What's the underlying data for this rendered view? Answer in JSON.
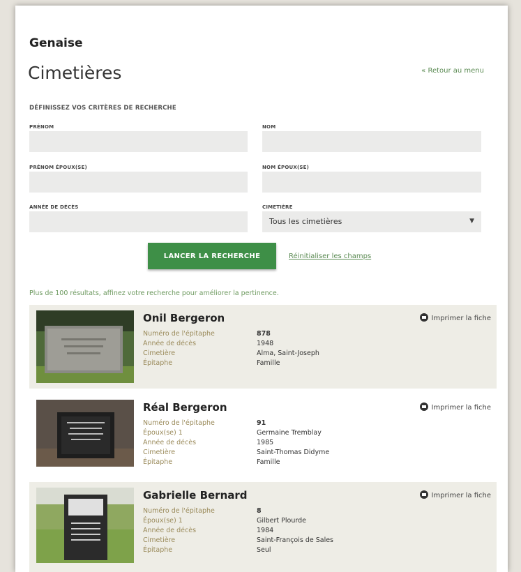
{
  "header": {
    "site_title": "Genaise",
    "page_title": "Cimetières",
    "back_link": "« Retour au menu"
  },
  "search": {
    "heading": "DÉFINISSEZ VOS CRITÈRES DE RECHERCHE",
    "fields": {
      "prenom": "PRÉNOM",
      "nom": "NOM",
      "prenom_epoux": "PRÉNOM ÉPOUX(SE)",
      "nom_epoux": "NOM ÉPOUX(SE)",
      "annee_deces": "ANNÉE DE DÉCÈS",
      "cimetiere": "CIMETIÈRE"
    },
    "cimetiere_selected": "Tous les cimetières",
    "search_button": "LANCER LA RECHERCHE",
    "reset_link": "Réinitialiser les champs",
    "notice": "Plus de 100 résultats, affinez votre recherche pour améliorer la pertinence."
  },
  "results": [
    {
      "name": "Onil Bergeron",
      "print_label": "Imprimer la fiche",
      "rows": [
        {
          "label": "Numéro de l'épitaphe",
          "value": "878"
        },
        {
          "label": "Année de décès",
          "value": "1948"
        },
        {
          "label": "Cimetière",
          "value": "Alma, Saint-Joseph"
        },
        {
          "label": "Épitaphe",
          "value": "Famille"
        }
      ]
    },
    {
      "name": "Réal Bergeron",
      "print_label": "Imprimer la fiche",
      "rows": [
        {
          "label": "Numéro de l'épitaphe",
          "value": "91"
        },
        {
          "label": "Époux(se) 1",
          "value": "Germaine Tremblay"
        },
        {
          "label": "Année de décès",
          "value": "1985"
        },
        {
          "label": "Cimetière",
          "value": "Saint-Thomas Didyme"
        },
        {
          "label": "Épitaphe",
          "value": "Famille"
        }
      ]
    },
    {
      "name": "Gabrielle Bernard",
      "print_label": "Imprimer la fiche",
      "rows": [
        {
          "label": "Numéro de l'épitaphe",
          "value": "8"
        },
        {
          "label": "Époux(se) 1",
          "value": "Gilbert Plourde"
        },
        {
          "label": "Année de décès",
          "value": "1984"
        },
        {
          "label": "Cimetière",
          "value": "Saint-François de Sales"
        },
        {
          "label": "Épitaphe",
          "value": "Seul"
        }
      ]
    }
  ],
  "colors": {
    "accent_green": "#3e8f47",
    "result_bg": "#eeede6",
    "label_color": "#9a8a5a"
  }
}
